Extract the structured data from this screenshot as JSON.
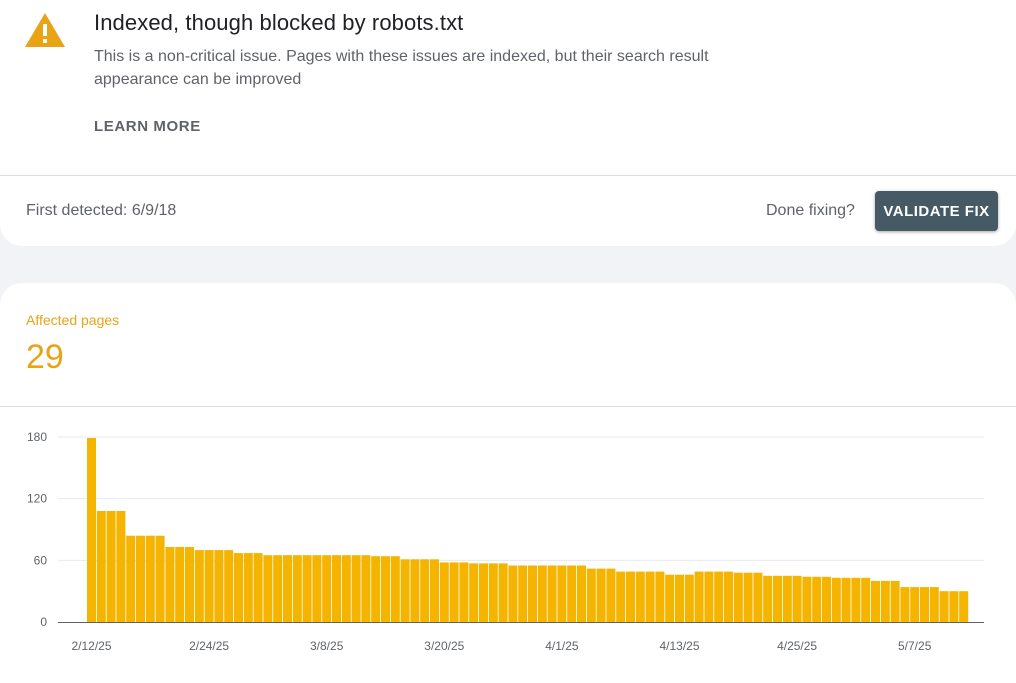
{
  "issue": {
    "title": "Indexed, though blocked by robots.txt",
    "description": "This is a non-critical issue. Pages with these issues are indexed, but their search result appearance can be improved",
    "learn_more": "LEARN MORE",
    "icon": "warning-icon",
    "accent_color": "#e8a317"
  },
  "status_bar": {
    "first_detected": "First detected: 6/9/18",
    "done_fixing": "Done fixing?",
    "validate_label": "VALIDATE FIX",
    "button_color": "#455a64"
  },
  "metric": {
    "label": "Affected pages",
    "value": "29",
    "color": "#e8a317"
  },
  "chart_data": {
    "type": "bar",
    "bar_color": "#f4b400",
    "ylim": [
      0,
      180
    ],
    "y_ticks": [
      0,
      60,
      120,
      180
    ],
    "x_tick_labels": [
      "2/12/25",
      "2/24/25",
      "3/8/25",
      "3/20/25",
      "4/1/25",
      "4/13/25",
      "4/25/25",
      "5/7/25"
    ],
    "x_tick_every": 12,
    "grid": true,
    "categories": [
      "2/12/25",
      "2/13/25",
      "2/14/25",
      "2/15/25",
      "2/16/25",
      "2/17/25",
      "2/18/25",
      "2/19/25",
      "2/20/25",
      "2/21/25",
      "2/22/25",
      "2/23/25",
      "2/24/25",
      "2/25/25",
      "2/26/25",
      "2/27/25",
      "2/28/25",
      "3/1/25",
      "3/2/25",
      "3/3/25",
      "3/4/25",
      "3/5/25",
      "3/6/25",
      "3/7/25",
      "3/8/25",
      "3/9/25",
      "3/10/25",
      "3/11/25",
      "3/12/25",
      "3/13/25",
      "3/14/25",
      "3/15/25",
      "3/16/25",
      "3/17/25",
      "3/18/25",
      "3/19/25",
      "3/20/25",
      "3/21/25",
      "3/22/25",
      "3/23/25",
      "3/24/25",
      "3/25/25",
      "3/26/25",
      "3/27/25",
      "3/28/25",
      "3/29/25",
      "3/30/25",
      "3/31/25",
      "4/1/25",
      "4/2/25",
      "4/3/25",
      "4/4/25",
      "4/5/25",
      "4/6/25",
      "4/7/25",
      "4/8/25",
      "4/9/25",
      "4/10/25",
      "4/11/25",
      "4/12/25",
      "4/13/25",
      "4/14/25",
      "4/15/25",
      "4/16/25",
      "4/17/25",
      "4/18/25",
      "4/19/25",
      "4/20/25",
      "4/21/25",
      "4/22/25",
      "4/23/25",
      "4/24/25",
      "4/25/25",
      "4/26/25",
      "4/27/25",
      "4/28/25",
      "4/29/25",
      "4/30/25",
      "5/1/25",
      "5/2/25",
      "5/3/25",
      "5/4/25",
      "5/5/25",
      "5/6/25",
      "5/7/25",
      "5/8/25",
      "5/9/25",
      "5/10/25",
      "5/11/25"
    ],
    "values": [
      179,
      108,
      108,
      108,
      84,
      84,
      84,
      84,
      73,
      73,
      73,
      70,
      70,
      70,
      70,
      67,
      67,
      67,
      65,
      65,
      65,
      65,
      65,
      65,
      65,
      65,
      65,
      65,
      65,
      64,
      64,
      64,
      61,
      61,
      61,
      61,
      58,
      58,
      58,
      57,
      57,
      57,
      57,
      55,
      55,
      55,
      55,
      55,
      55,
      55,
      55,
      52,
      52,
      52,
      49,
      49,
      49,
      49,
      49,
      46,
      46,
      46,
      49,
      49,
      49,
      49,
      48,
      48,
      48,
      45,
      45,
      45,
      45,
      44,
      44,
      44,
      43,
      43,
      43,
      43,
      40,
      40,
      40,
      34,
      34,
      34,
      34,
      30,
      30,
      30
    ]
  }
}
